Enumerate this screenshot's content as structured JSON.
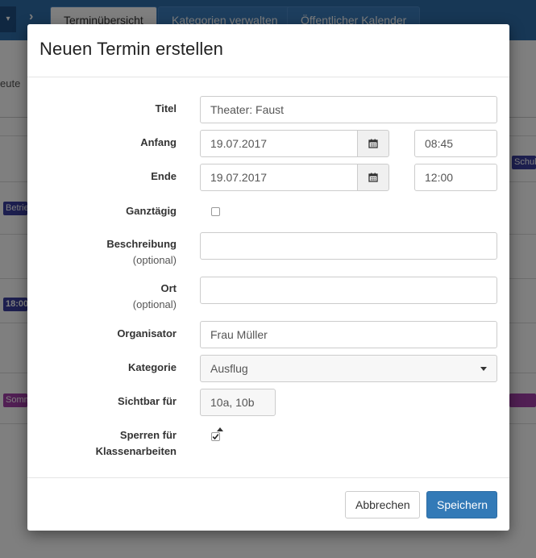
{
  "background": {
    "nav_tabs": [
      "Terminübersicht",
      "Kategorien verwalten",
      "Öffentlicher Kalender"
    ],
    "toolbar_text": "eute",
    "events": {
      "right_top": "Schul",
      "left_1": "Betrie",
      "left_2": "18:00",
      "left_3": "Somm"
    },
    "colors": {
      "navbar": "#2f6eab",
      "event_blue": "#3a3f9e",
      "event_purple": "#a23fa8"
    }
  },
  "modal": {
    "title": "Neuen Termin erstellen",
    "fields": {
      "title": {
        "label": "Titel",
        "value": "Theater: Faust"
      },
      "start": {
        "label": "Anfang",
        "date": "19.07.2017",
        "time": "08:45"
      },
      "end": {
        "label": "Ende",
        "date": "19.07.2017",
        "time": "12:00"
      },
      "all_day": {
        "label": "Ganztägig",
        "checked": false
      },
      "description": {
        "label": "Beschreibung",
        "optional": "(optional)",
        "value": ""
      },
      "location": {
        "label": "Ort",
        "optional": "(optional)",
        "value": ""
      },
      "organizer": {
        "label": "Organisator",
        "value": "Frau Müller"
      },
      "category": {
        "label": "Kategorie",
        "value": "Ausflug"
      },
      "visible_for": {
        "label": "Sichtbar für",
        "value": "10a, 10b"
      },
      "block_exams": {
        "label_line1": "Sperren für",
        "label_line2": "Klassenarbeiten",
        "checked": true
      }
    },
    "buttons": {
      "cancel": "Abbrechen",
      "save": "Speichern"
    },
    "icons": {
      "calendar": "calendar-icon",
      "check": "check-icon",
      "caret_down": "caret-down-icon",
      "caret_up": "caret-up-icon"
    },
    "colors": {
      "primary": "#337ab7"
    }
  }
}
